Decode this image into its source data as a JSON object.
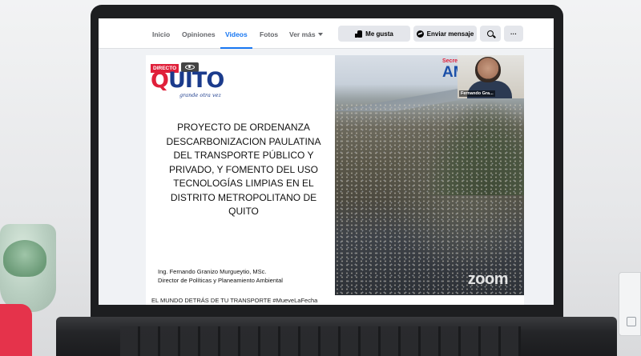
{
  "navbar": {
    "tabs": [
      {
        "label": "Inicio"
      },
      {
        "label": "Opiniones"
      },
      {
        "label": "Videos"
      },
      {
        "label": "Fotos"
      },
      {
        "label": "Ver más"
      }
    ],
    "like_label": "Me gusta",
    "message_label": "Enviar mensaje",
    "more_label": "···"
  },
  "video": {
    "live_badge": "DIRECTO",
    "logo_text_q": "Q",
    "logo_text_rest": "UITO",
    "logo_tagline": "grande otra vez",
    "slide_title": "PROYECTO DE ORDENANZA DESCARBONIZACION PAULATINA DEL TRANSPORTE PÚBLICO Y PRIVADO, Y FOMENTO DEL USO TECNOLOGÍAS LIMPIAS EN EL DISTRITO METROPOLITANO DE QUITO",
    "author_line1": "Ing. Fernando Granizo Murgueytio, MSc.",
    "author_line2": "Director de Políticas y Planeamiento Ambiental",
    "photo_label_small": "Secre",
    "photo_label_big": "AM",
    "camera_name": "Fernando Gra...",
    "watermark": "zoom"
  },
  "caption": "EL MUNDO DETRÁS DE TU TRANSPORTE #MueveLaFecha",
  "colors": {
    "accent": "#1877f2",
    "brand_red": "#e0203a",
    "brand_blue": "#1b3b8c"
  }
}
